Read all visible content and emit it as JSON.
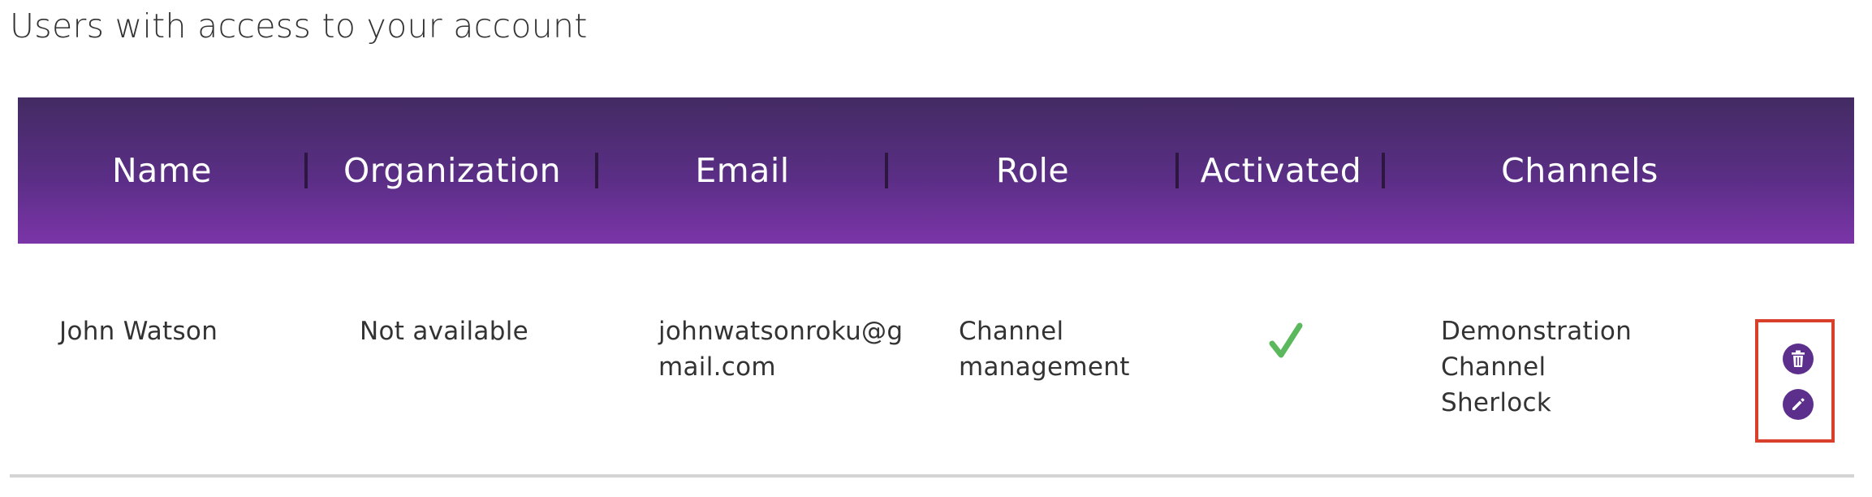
{
  "page": {
    "title": "Users with access to your account"
  },
  "table": {
    "columns": [
      {
        "key": "name",
        "label": "Name"
      },
      {
        "key": "organization",
        "label": "Organization"
      },
      {
        "key": "email",
        "label": "Email"
      },
      {
        "key": "role",
        "label": "Role"
      },
      {
        "key": "activated",
        "label": "Activated"
      },
      {
        "key": "channels",
        "label": "Channels"
      }
    ],
    "rows": [
      {
        "name": "John Watson",
        "organization": "Not available",
        "email_lines": [
          "johnwatsonroku@g",
          "mail.com"
        ],
        "role_lines": [
          "Channel",
          "management"
        ],
        "activated": true,
        "channels_lines": [
          "Demonstration",
          "Channel",
          "Sherlock"
        ]
      }
    ]
  },
  "icons": {
    "activated": "checkmark-icon",
    "delete": "trash-icon",
    "edit": "pencil-icon"
  },
  "colors": {
    "header_top": "#432b63",
    "header_bottom": "#7b35a8",
    "check": "#5cb85c",
    "action_button": "#5d2f8c",
    "highlight_border": "#d9402b"
  }
}
